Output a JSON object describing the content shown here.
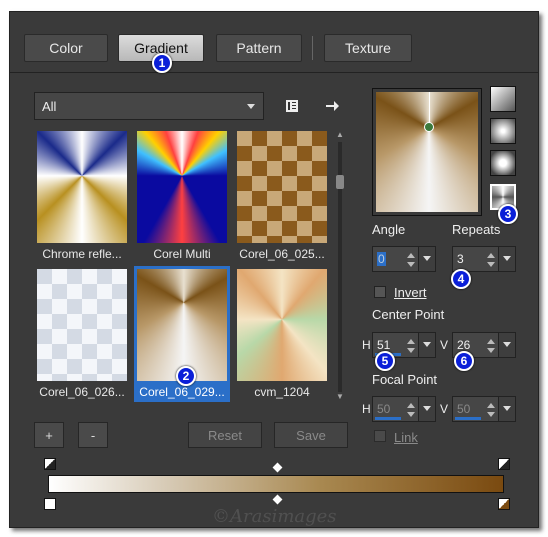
{
  "tabs": [
    {
      "label": "Color",
      "active": false
    },
    {
      "label": "Gradient",
      "active": true
    },
    {
      "label": "Pattern",
      "active": false
    },
    {
      "label": "Texture",
      "active": false
    }
  ],
  "badges": [
    "1",
    "2",
    "3",
    "4",
    "5",
    "6"
  ],
  "library": {
    "selected": "All",
    "folder_icon": "book-icon",
    "arrow_icon": "arrow-right-icon"
  },
  "thumbnails": [
    {
      "caption": "Chrome refle...",
      "selected": false
    },
    {
      "caption": "Corel Multi",
      "selected": false
    },
    {
      "caption": "Corel_06_025...",
      "selected": false
    },
    {
      "caption": "Corel_06_026...",
      "selected": false
    },
    {
      "caption": "Corel_06_029...",
      "selected": true
    },
    {
      "caption": "cvm_1204",
      "selected": false
    }
  ],
  "buttons": {
    "add": "+",
    "remove": "-",
    "reset": "Reset",
    "save": "Save"
  },
  "angle": {
    "label": "Angle",
    "value": "0"
  },
  "repeats": {
    "label": "Repeats",
    "value": "3"
  },
  "invert": {
    "label": "Invert",
    "checked": false
  },
  "center_point": {
    "label": "Center Point",
    "h_label": "H",
    "h_value": "51",
    "v_label": "V",
    "v_value": "26"
  },
  "focal_point": {
    "label": "Focal Point",
    "h_label": "H",
    "h_value": "50",
    "v_label": "V",
    "v_value": "50"
  },
  "link": {
    "label": "Link",
    "checked": false
  },
  "watermark": "©Arasimages",
  "colors": {
    "accent": "#2b6fc8",
    "badge": "#0a1fd8",
    "panel": "#3a3a3a"
  }
}
